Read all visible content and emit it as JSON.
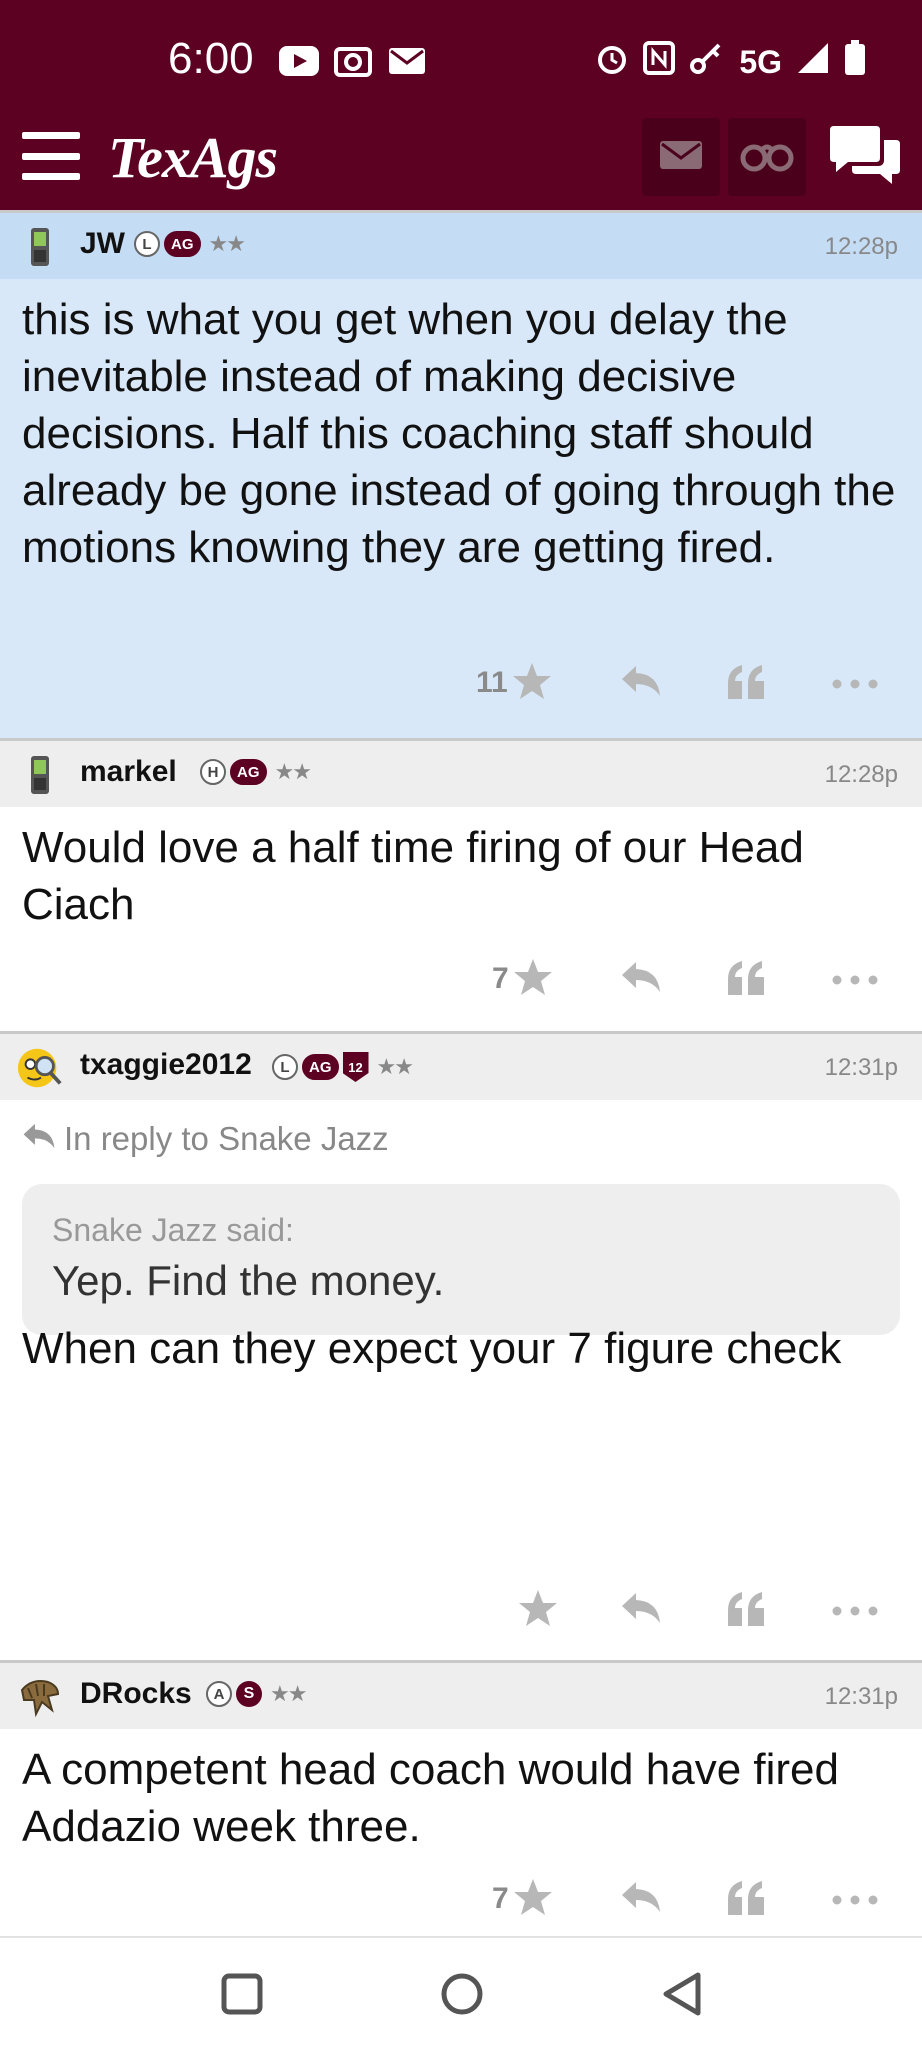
{
  "status_bar": {
    "time": "6:00",
    "network": "5G",
    "icons": [
      "youtube-icon",
      "camera-icon",
      "mail-icon",
      "alarm-icon",
      "nfc-icon",
      "key-icon",
      "signal-icon",
      "battery-icon"
    ]
  },
  "header": {
    "logo": "TexAgs",
    "icons": [
      "menu-icon",
      "messages-icon",
      "binoculars-icon",
      "chat-icon"
    ],
    "brand_color": "#5c0122"
  },
  "posts": [
    {
      "user": "JW",
      "badges": [
        "L",
        "AG"
      ],
      "rank": "★★",
      "time": "12:28p",
      "body": "this is what you get when you delay the inevitable instead of making decisive decisions. Half this coaching staff should already be gone instead of going through the motions knowing they are getting fired.",
      "likes": "11",
      "highlighted": true
    },
    {
      "user": "markel",
      "badges": [
        "H",
        "AG"
      ],
      "rank": "★★",
      "time": "12:28p",
      "body": "Would love a half time firing of our Head Ciach",
      "likes": "7"
    },
    {
      "user": "txaggie2012",
      "badges": [
        "L",
        "AG",
        "12"
      ],
      "rank": "★★",
      "time": "12:31p",
      "in_reply_to": "In reply to Snake Jazz",
      "quote_author": "Snake Jazz said:",
      "quote_text": "Yep. Find the money.",
      "body": "When can they expect your 7 figure check",
      "likes": ""
    },
    {
      "user": "DRocks",
      "badges": [
        "A",
        "S"
      ],
      "rank": "★★",
      "time": "12:31p",
      "body": "A competent head coach would have fired Addazio week three.",
      "likes": "7"
    }
  ],
  "nav": {
    "icons": [
      "recents-icon",
      "home-icon",
      "back-icon"
    ]
  }
}
